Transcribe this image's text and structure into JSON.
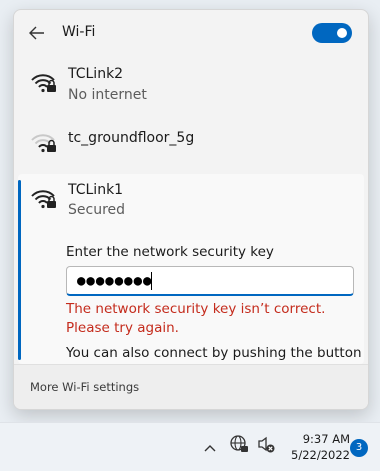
{
  "header": {
    "title": "Wi-Fi",
    "back_icon": "back-arrow-icon",
    "toggle_on": true
  },
  "networks": [
    {
      "name": "TCLink2",
      "status": "No internet",
      "icon": "wifi-secured-icon"
    },
    {
      "name": "tc_groundfloor_5g",
      "status": "",
      "icon": "wifi-secured-icon"
    }
  ],
  "expanded": {
    "name": "TCLink1",
    "status": "Secured",
    "icon": "wifi-secured-icon",
    "key_label": "Enter the network security key",
    "key_value": "●●●●●●●●",
    "error": "The network security key isn’t correct. Please try again.",
    "wps_text": "You can also connect by pushing the button"
  },
  "footer": {
    "more_settings": "More Wi-Fi settings"
  },
  "taskbar": {
    "time": "9:37 AM",
    "date": "5/22/2022",
    "notification_count": "3"
  },
  "colors": {
    "accent": "#0067c0",
    "error": "#c42b1c"
  }
}
